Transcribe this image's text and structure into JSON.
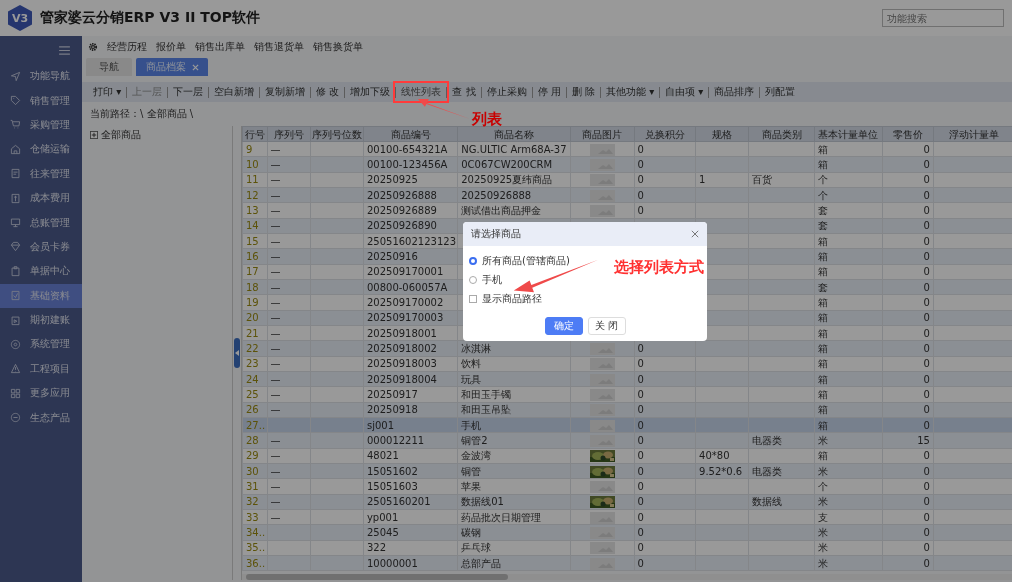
{
  "header": {
    "logo": "V3",
    "title": "管家婆云分销ERP V3 II TOP软件",
    "search": {
      "placeholder": "功能搜索"
    }
  },
  "sidebar": {
    "items": [
      {
        "label": "功能导航",
        "selected": false
      },
      {
        "label": "销售管理",
        "selected": false
      },
      {
        "label": "采购管理",
        "selected": false
      },
      {
        "label": "仓储运输",
        "selected": false
      },
      {
        "label": "往来管理",
        "selected": false
      },
      {
        "label": "成本费用",
        "selected": false
      },
      {
        "label": "总账管理",
        "selected": false
      },
      {
        "label": "会员卡券",
        "selected": false
      },
      {
        "label": "单据中心",
        "selected": false
      },
      {
        "label": "基础资料",
        "selected": true
      },
      {
        "label": "期初建账",
        "selected": false
      },
      {
        "label": "系统管理",
        "selected": false
      },
      {
        "label": "工程项目",
        "selected": false
      },
      {
        "label": "更多应用",
        "selected": false
      },
      {
        "label": "生态产品",
        "selected": false
      }
    ]
  },
  "quick_links": [
    "经营历程",
    "报价单",
    "销售出库单",
    "销售退货单",
    "销售换货单"
  ],
  "tabs": [
    {
      "label": "导航",
      "selected": false
    },
    {
      "label": "商品档案",
      "selected": true
    }
  ],
  "toolbar": [
    {
      "label": "打印 ▾",
      "disabled": false,
      "marked": false
    },
    {
      "label": "上一层",
      "disabled": true,
      "marked": false
    },
    {
      "label": "下一层",
      "disabled": false,
      "marked": false
    },
    {
      "label": "空白新增",
      "disabled": false,
      "marked": false
    },
    {
      "label": "复制新增",
      "disabled": false,
      "marked": false
    },
    {
      "label": "修 改",
      "disabled": false,
      "marked": false
    },
    {
      "label": "增加下级",
      "disabled": false,
      "marked": false
    },
    {
      "label": "线性列表",
      "disabled": false,
      "marked": true
    },
    {
      "label": "查 找",
      "disabled": false,
      "marked": false
    },
    {
      "label": "停止采购",
      "disabled": false,
      "marked": false
    },
    {
      "label": "停 用",
      "disabled": false,
      "marked": false
    },
    {
      "label": "删 除",
      "disabled": false,
      "marked": false
    },
    {
      "label": "其他功能 ▾",
      "disabled": false,
      "marked": false
    },
    {
      "label": "自由项 ▾",
      "disabled": false,
      "marked": false
    },
    {
      "label": "商品排序",
      "disabled": false,
      "marked": false
    },
    {
      "label": "列配置",
      "disabled": false,
      "marked": false
    }
  ],
  "path": "当前路径：\\ 全部商品 \\",
  "tree": {
    "label": "全部商品",
    "expanded": false
  },
  "table": {
    "columns": [
      "行号",
      "序列号",
      "序列号位数",
      "商品编号",
      "商品名称",
      "商品图片",
      "兑换积分",
      "规格",
      "商品类别",
      "基本计量单位",
      "零售价",
      "浮动计量单"
    ],
    "rows": [
      {
        "no": "9",
        "serial": "—",
        "code": "00100-654321A",
        "name": "NG.ULTIC Arm68A-37",
        "kind": "placeholder",
        "points": "0",
        "unit": "箱",
        "price": "0",
        "selected": false
      },
      {
        "no": "10",
        "serial": "—",
        "code": "00100-123456A",
        "name": "0C067CW200CRM",
        "kind": "placeholder",
        "points": "0",
        "unit": "箱",
        "price": "0",
        "selected": false
      },
      {
        "no": "11",
        "serial": "—",
        "code": "20250925",
        "name": "20250925夏纬商品",
        "kind": "placeholder",
        "points": "0",
        "spec": "1",
        "category": "百货",
        "unit": "个",
        "price": "0",
        "selected": false
      },
      {
        "no": "12",
        "serial": "—",
        "code": "20250926888",
        "name": "20250926888",
        "kind": "placeholder",
        "points": "0",
        "unit": "个",
        "price": "0",
        "selected": false
      },
      {
        "no": "13",
        "serial": "—",
        "code": "20250926889",
        "name": "测试借出商品押金",
        "kind": "placeholder",
        "points": "0",
        "unit": "套",
        "price": "0",
        "selected": false
      },
      {
        "no": "14",
        "serial": "—",
        "code": "20250926890",
        "unit": "套",
        "price": "0",
        "selected": false
      },
      {
        "no": "15",
        "serial": "—",
        "code": "25051602123123",
        "unit": "箱",
        "price": "0",
        "selected": false
      },
      {
        "no": "16",
        "serial": "—",
        "code": "20250916",
        "unit": "箱",
        "price": "0",
        "selected": false
      },
      {
        "no": "17",
        "serial": "—",
        "code": "202509170001",
        "unit": "箱",
        "price": "0",
        "selected": false
      },
      {
        "no": "18",
        "serial": "—",
        "code": "00800-060057A",
        "unit": "套",
        "price": "0",
        "selected": false
      },
      {
        "no": "19",
        "serial": "—",
        "code": "202509170002",
        "unit": "箱",
        "price": "0",
        "selected": false
      },
      {
        "no": "20",
        "serial": "—",
        "code": "202509170003",
        "unit": "箱",
        "price": "0",
        "selected": false
      },
      {
        "no": "21",
        "serial": "—",
        "code": "20250918001",
        "unit": "箱",
        "price": "0",
        "selected": false
      },
      {
        "no": "22",
        "serial": "—",
        "code": "20250918002",
        "name": "冰淇淋",
        "kind": "placeholder",
        "points": "0",
        "unit": "箱",
        "price": "0",
        "selected": false
      },
      {
        "no": "23",
        "serial": "—",
        "code": "20250918003",
        "name": "饮料",
        "kind": "placeholder",
        "points": "0",
        "unit": "箱",
        "price": "0",
        "selected": false
      },
      {
        "no": "24",
        "serial": "—",
        "code": "20250918004",
        "name": "玩具",
        "kind": "placeholder",
        "points": "0",
        "unit": "箱",
        "price": "0",
        "selected": false
      },
      {
        "no": "25",
        "serial": "—",
        "code": "20250917",
        "name": "和田玉手镯",
        "kind": "placeholder",
        "points": "0",
        "unit": "箱",
        "price": "0",
        "selected": false
      },
      {
        "no": "26",
        "serial": "—",
        "code": "20250918",
        "name": "和田玉吊坠",
        "kind": "placeholder",
        "points": "0",
        "unit": "箱",
        "price": "0",
        "selected": false
      },
      {
        "no": "27..",
        "code": "sj001",
        "name": "手机",
        "kind": "placeholder",
        "points": "0",
        "unit": "箱",
        "price": "0",
        "selected": true
      },
      {
        "no": "28",
        "serial": "—",
        "code": "000012211",
        "name": "铜管2",
        "kind": "placeholder",
        "points": "0",
        "category": "电器类",
        "unit": "米",
        "price": "15",
        "selected": false
      },
      {
        "no": "29",
        "serial": "—",
        "code": "48021",
        "name": "金波湾",
        "points": "0",
        "spec": "40*80",
        "unit": "箱",
        "price": "0",
        "selected": false
      },
      {
        "no": "30",
        "serial": "—",
        "code": "15051602",
        "name": "铜管",
        "points": "0",
        "spec": "9.52*0.6",
        "category": "电器类",
        "unit": "米",
        "price": "0",
        "selected": false
      },
      {
        "no": "31",
        "serial": "—",
        "code": "15051603",
        "name": "苹果",
        "kind": "placeholder",
        "points": "0",
        "unit": "个",
        "price": "0",
        "selected": false
      },
      {
        "no": "32",
        "serial": "—",
        "code": "2505160201",
        "name": "数据线01",
        "points": "0",
        "category": "数据线",
        "unit": "米",
        "price": "0",
        "selected": false
      },
      {
        "no": "33",
        "serial": "—",
        "code": "yp001",
        "name": "药品批次日期管理",
        "kind": "placeholder",
        "points": "0",
        "unit": "支",
        "price": "0",
        "selected": false
      },
      {
        "no": "34..",
        "code": "25045",
        "name": "碳钢",
        "kind": "placeholder",
        "points": "0",
        "unit": "米",
        "price": "0",
        "selected": false
      },
      {
        "no": "35..",
        "code": "322",
        "name": "乒乓球",
        "kind": "placeholder",
        "points": "0",
        "unit": "米",
        "price": "0",
        "selected": false
      },
      {
        "no": "36..",
        "code": "10000001",
        "name": "总部产品",
        "kind": "placeholder",
        "points": "0",
        "unit": "米",
        "price": "0",
        "selected": false
      }
    ]
  },
  "dialog": {
    "title": "请选择商品",
    "options": [
      {
        "label": "所有商品(管辖商品)",
        "selected": true
      },
      {
        "label": "手机",
        "selected": false
      }
    ],
    "show_path": {
      "label": "显示商品路径",
      "checked": false
    },
    "buttons": [
      {
        "label": "确定",
        "kind": "primary"
      },
      {
        "label": "关 闭",
        "kind": "default"
      }
    ]
  },
  "annotations": [
    {
      "kind": "arrow"
    },
    {
      "kind": "label",
      "text": "列表"
    },
    {
      "kind": "arrow"
    },
    {
      "kind": "label",
      "text": "选择列表方式"
    }
  ]
}
